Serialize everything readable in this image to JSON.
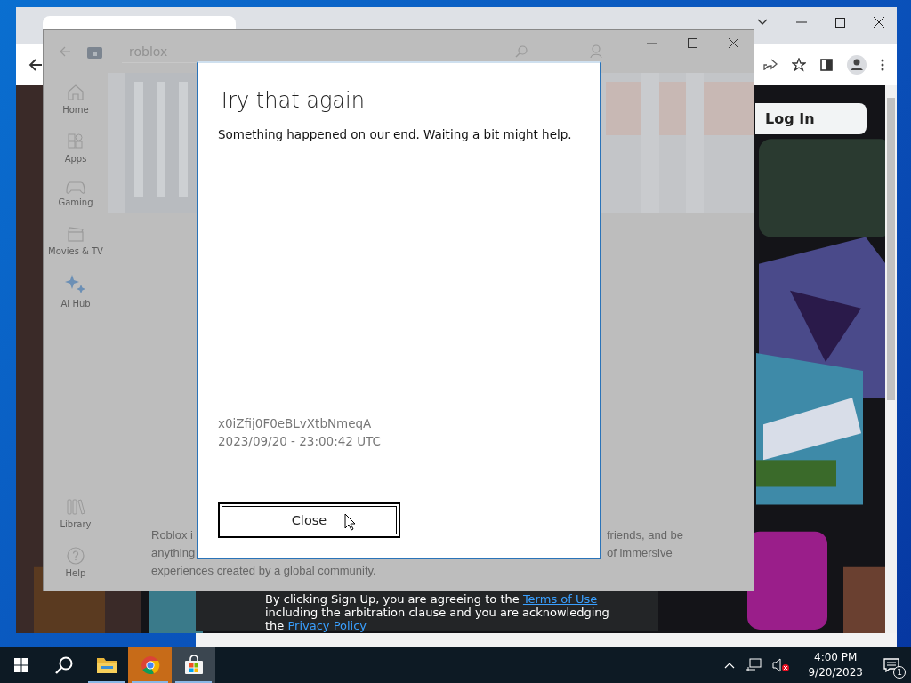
{
  "browser": {
    "login_button": "Log In",
    "consent": {
      "before": "By clicking Sign Up, you are agreeing to the ",
      "terms_link": "Terms of Use",
      "middle": " including the arbitration clause and you are acknowledging the ",
      "privacy_link": "Privacy Policy"
    }
  },
  "store": {
    "search": "roblox",
    "nav": [
      {
        "label": "Home",
        "kind": "home"
      },
      {
        "label": "Apps",
        "kind": "apps"
      },
      {
        "label": "Gaming",
        "kind": "gaming"
      },
      {
        "label": "Movies & TV",
        "kind": "movies"
      },
      {
        "label": "AI Hub",
        "kind": "ai"
      }
    ],
    "nav_bottom": [
      {
        "label": "Library",
        "kind": "library"
      },
      {
        "label": "Help",
        "kind": "help"
      }
    ],
    "description_left": [
      "Roblox i",
      "anything",
      "experiences created by a global community."
    ],
    "description_right": [
      "friends, and be",
      "of immersive"
    ]
  },
  "dialog": {
    "title": "Try that again",
    "message": "Something happened on our end. Waiting a bit might help.",
    "code": "x0iZfij0F0eBLvXtbNmeqA",
    "timestamp": "2023/09/20 - 23:00:42 UTC",
    "button": "Close"
  },
  "taskbar": {
    "apps": [
      {
        "kind": "explorer",
        "flashing": false,
        "selected": false
      },
      {
        "kind": "chrome",
        "flashing": true,
        "selected": false
      },
      {
        "kind": "store",
        "flashing": false,
        "selected": true
      }
    ],
    "time": "4:00 PM",
    "date": "9/20/2023",
    "notifications": "1"
  }
}
